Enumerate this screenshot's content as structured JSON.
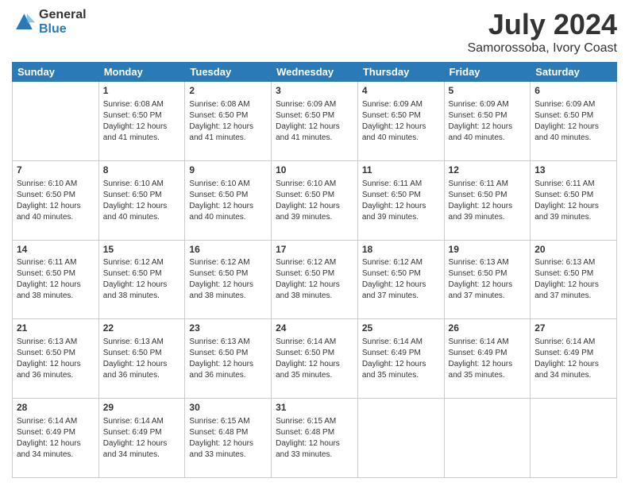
{
  "logo": {
    "general": "General",
    "blue": "Blue"
  },
  "title": "July 2024",
  "subtitle": "Samorossoba, Ivory Coast",
  "days_header": [
    "Sunday",
    "Monday",
    "Tuesday",
    "Wednesday",
    "Thursday",
    "Friday",
    "Saturday"
  ],
  "weeks": [
    [
      {
        "day": "",
        "sunrise": "",
        "sunset": "",
        "daylight": ""
      },
      {
        "day": "1",
        "sunrise": "Sunrise: 6:08 AM",
        "sunset": "Sunset: 6:50 PM",
        "daylight": "Daylight: 12 hours and 41 minutes."
      },
      {
        "day": "2",
        "sunrise": "Sunrise: 6:08 AM",
        "sunset": "Sunset: 6:50 PM",
        "daylight": "Daylight: 12 hours and 41 minutes."
      },
      {
        "day": "3",
        "sunrise": "Sunrise: 6:09 AM",
        "sunset": "Sunset: 6:50 PM",
        "daylight": "Daylight: 12 hours and 41 minutes."
      },
      {
        "day": "4",
        "sunrise": "Sunrise: 6:09 AM",
        "sunset": "Sunset: 6:50 PM",
        "daylight": "Daylight: 12 hours and 40 minutes."
      },
      {
        "day": "5",
        "sunrise": "Sunrise: 6:09 AM",
        "sunset": "Sunset: 6:50 PM",
        "daylight": "Daylight: 12 hours and 40 minutes."
      },
      {
        "day": "6",
        "sunrise": "Sunrise: 6:09 AM",
        "sunset": "Sunset: 6:50 PM",
        "daylight": "Daylight: 12 hours and 40 minutes."
      }
    ],
    [
      {
        "day": "7",
        "sunrise": "Sunrise: 6:10 AM",
        "sunset": "Sunset: 6:50 PM",
        "daylight": "Daylight: 12 hours and 40 minutes."
      },
      {
        "day": "8",
        "sunrise": "Sunrise: 6:10 AM",
        "sunset": "Sunset: 6:50 PM",
        "daylight": "Daylight: 12 hours and 40 minutes."
      },
      {
        "day": "9",
        "sunrise": "Sunrise: 6:10 AM",
        "sunset": "Sunset: 6:50 PM",
        "daylight": "Daylight: 12 hours and 40 minutes."
      },
      {
        "day": "10",
        "sunrise": "Sunrise: 6:10 AM",
        "sunset": "Sunset: 6:50 PM",
        "daylight": "Daylight: 12 hours and 39 minutes."
      },
      {
        "day": "11",
        "sunrise": "Sunrise: 6:11 AM",
        "sunset": "Sunset: 6:50 PM",
        "daylight": "Daylight: 12 hours and 39 minutes."
      },
      {
        "day": "12",
        "sunrise": "Sunrise: 6:11 AM",
        "sunset": "Sunset: 6:50 PM",
        "daylight": "Daylight: 12 hours and 39 minutes."
      },
      {
        "day": "13",
        "sunrise": "Sunrise: 6:11 AM",
        "sunset": "Sunset: 6:50 PM",
        "daylight": "Daylight: 12 hours and 39 minutes."
      }
    ],
    [
      {
        "day": "14",
        "sunrise": "Sunrise: 6:11 AM",
        "sunset": "Sunset: 6:50 PM",
        "daylight": "Daylight: 12 hours and 38 minutes."
      },
      {
        "day": "15",
        "sunrise": "Sunrise: 6:12 AM",
        "sunset": "Sunset: 6:50 PM",
        "daylight": "Daylight: 12 hours and 38 minutes."
      },
      {
        "day": "16",
        "sunrise": "Sunrise: 6:12 AM",
        "sunset": "Sunset: 6:50 PM",
        "daylight": "Daylight: 12 hours and 38 minutes."
      },
      {
        "day": "17",
        "sunrise": "Sunrise: 6:12 AM",
        "sunset": "Sunset: 6:50 PM",
        "daylight": "Daylight: 12 hours and 38 minutes."
      },
      {
        "day": "18",
        "sunrise": "Sunrise: 6:12 AM",
        "sunset": "Sunset: 6:50 PM",
        "daylight": "Daylight: 12 hours and 37 minutes."
      },
      {
        "day": "19",
        "sunrise": "Sunrise: 6:13 AM",
        "sunset": "Sunset: 6:50 PM",
        "daylight": "Daylight: 12 hours and 37 minutes."
      },
      {
        "day": "20",
        "sunrise": "Sunrise: 6:13 AM",
        "sunset": "Sunset: 6:50 PM",
        "daylight": "Daylight: 12 hours and 37 minutes."
      }
    ],
    [
      {
        "day": "21",
        "sunrise": "Sunrise: 6:13 AM",
        "sunset": "Sunset: 6:50 PM",
        "daylight": "Daylight: 12 hours and 36 minutes."
      },
      {
        "day": "22",
        "sunrise": "Sunrise: 6:13 AM",
        "sunset": "Sunset: 6:50 PM",
        "daylight": "Daylight: 12 hours and 36 minutes."
      },
      {
        "day": "23",
        "sunrise": "Sunrise: 6:13 AM",
        "sunset": "Sunset: 6:50 PM",
        "daylight": "Daylight: 12 hours and 36 minutes."
      },
      {
        "day": "24",
        "sunrise": "Sunrise: 6:14 AM",
        "sunset": "Sunset: 6:50 PM",
        "daylight": "Daylight: 12 hours and 35 minutes."
      },
      {
        "day": "25",
        "sunrise": "Sunrise: 6:14 AM",
        "sunset": "Sunset: 6:49 PM",
        "daylight": "Daylight: 12 hours and 35 minutes."
      },
      {
        "day": "26",
        "sunrise": "Sunrise: 6:14 AM",
        "sunset": "Sunset: 6:49 PM",
        "daylight": "Daylight: 12 hours and 35 minutes."
      },
      {
        "day": "27",
        "sunrise": "Sunrise: 6:14 AM",
        "sunset": "Sunset: 6:49 PM",
        "daylight": "Daylight: 12 hours and 34 minutes."
      }
    ],
    [
      {
        "day": "28",
        "sunrise": "Sunrise: 6:14 AM",
        "sunset": "Sunset: 6:49 PM",
        "daylight": "Daylight: 12 hours and 34 minutes."
      },
      {
        "day": "29",
        "sunrise": "Sunrise: 6:14 AM",
        "sunset": "Sunset: 6:49 PM",
        "daylight": "Daylight: 12 hours and 34 minutes."
      },
      {
        "day": "30",
        "sunrise": "Sunrise: 6:15 AM",
        "sunset": "Sunset: 6:48 PM",
        "daylight": "Daylight: 12 hours and 33 minutes."
      },
      {
        "day": "31",
        "sunrise": "Sunrise: 6:15 AM",
        "sunset": "Sunset: 6:48 PM",
        "daylight": "Daylight: 12 hours and 33 minutes."
      },
      {
        "day": "",
        "sunrise": "",
        "sunset": "",
        "daylight": ""
      },
      {
        "day": "",
        "sunrise": "",
        "sunset": "",
        "daylight": ""
      },
      {
        "day": "",
        "sunrise": "",
        "sunset": "",
        "daylight": ""
      }
    ]
  ]
}
